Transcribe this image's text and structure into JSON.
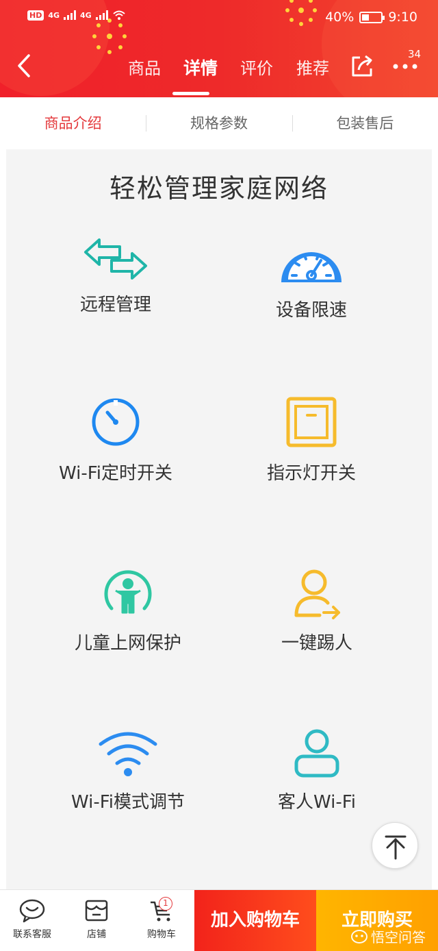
{
  "status_bar": {
    "hd": "HD",
    "signal1": "4G",
    "signal2": "4G",
    "battery": "40%",
    "time": "9:10"
  },
  "header": {
    "tabs": [
      {
        "label": "商品",
        "active": false
      },
      {
        "label": "详情",
        "active": true
      },
      {
        "label": "评价",
        "active": false
      },
      {
        "label": "推荐",
        "active": false
      }
    ],
    "message_count": "34",
    "accent": "#e4393c"
  },
  "subtabs": [
    {
      "label": "商品介绍",
      "active": true
    },
    {
      "label": "规格参数",
      "active": false
    },
    {
      "label": "包装售后",
      "active": false
    }
  ],
  "panel": {
    "title": "轻松管理家庭网络",
    "features": [
      {
        "label": "远程管理",
        "icon": "remote-arrows-icon"
      },
      {
        "label": "设备限速",
        "icon": "speedometer-icon"
      },
      {
        "label": "Wi-Fi定时开关",
        "icon": "timer-icon"
      },
      {
        "label": "指示灯开关",
        "icon": "light-switch-icon"
      },
      {
        "label": "儿童上网保护",
        "icon": "child-protect-icon"
      },
      {
        "label": "一键踢人",
        "icon": "kick-user-icon"
      },
      {
        "label": "Wi-Fi模式调节",
        "icon": "wifi-icon"
      },
      {
        "label": "客人Wi-Fi",
        "icon": "guest-user-icon"
      }
    ]
  },
  "bottom_bar": {
    "customer_service": "联系客服",
    "store": "店铺",
    "cart": "购物车",
    "cart_count": "1",
    "add_to_cart": "加入购物车",
    "buy_now": "立即购买"
  },
  "watermark": "悟空问答"
}
